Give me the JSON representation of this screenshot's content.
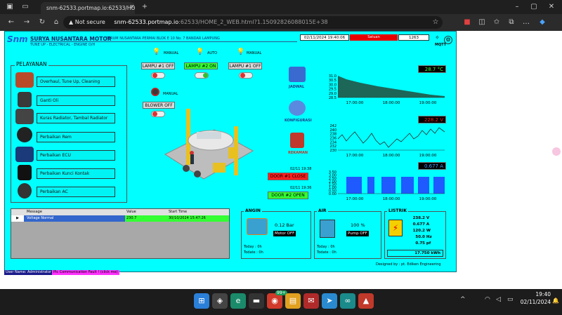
{
  "browser": {
    "tab_title": "snm-62533.portmap.io:62533/HO",
    "not_secure": "Not secure",
    "url_host": "snm-62533.portmap.io",
    "url_path": ":62533/HOME_2_WEB.html?1.15092826088015E+38"
  },
  "app": {
    "company": "SURYA NUSANTARA MOTOR",
    "tagline": "TUNE UP - ELECTRICAL - ENGINE O/H",
    "address": "PERUM NUSANTARA PERMAI BLOK E 10 No. 7    BANDAR LAMPUNG",
    "datetime": "02/11/2024  19:40:06",
    "status_label": "Satuan",
    "status_value": "1263",
    "logo_text": "Snm",
    "right_logo": "MQTT"
  },
  "services": {
    "title": "PELAYANAN",
    "items": [
      {
        "label": "Overhaul, Tune Up, Cleaning"
      },
      {
        "label": "Ganti Oli"
      },
      {
        "label": "Kuras Radiator, Tambal Radiator"
      },
      {
        "label": "Perbaikan Rem"
      },
      {
        "label": "Perbaikan ECU"
      },
      {
        "label": "Perbaikan Kunci Kontak"
      },
      {
        "label": "Perbaikan AC"
      }
    ]
  },
  "lamps": [
    {
      "mode": "MANUAL",
      "button": "LAMPU #1 OFF",
      "state": "OFF",
      "color": "#d9d9d9"
    },
    {
      "mode": "AUTO",
      "button": "LAMPU #2 ON",
      "state": "ON",
      "color": "#33ff33"
    },
    {
      "mode": "MANUAL",
      "button": "LAMPU #1 OFF",
      "state": "OFF",
      "color": "#d9d9d9"
    }
  ],
  "blower": {
    "mode": "MANUAL",
    "button": "BLOWER OFF",
    "state": "OFF"
  },
  "nav": {
    "jadwal": "JADWAL",
    "konfigurasi": "KONFIGURASI",
    "rekaman": "REKAMAN"
  },
  "doors": [
    {
      "time": "02/11  19:38",
      "label": "DOOR #1 CLOSE",
      "color": "#ff2020"
    },
    {
      "time": "02/11  19:36",
      "label": "DOOR #2 OPEN",
      "color": "#33ff33"
    }
  ],
  "trends": [
    {
      "value": "28.7 °C",
      "yticks": [
        "31.0",
        "30.5",
        "30.0",
        "29.5",
        "29.0",
        "28.5"
      ],
      "xticks": [
        "17:00:00",
        "18:00:00",
        "19:00:00"
      ],
      "color": "#1f5f4f",
      "green": true
    },
    {
      "value": "228.2 V",
      "yticks": [
        "242",
        "240",
        "238",
        "236",
        "234",
        "232",
        "230"
      ],
      "xticks": [
        "17:00:00",
        "18:00:00",
        "19:00:00"
      ],
      "color": "#2b2b2b",
      "green": false
    },
    {
      "value": "0.677 A",
      "yticks": [
        "3.50",
        "3.00",
        "2.50",
        "2.00",
        "1.50",
        "1.00",
        "0.50",
        "0.00"
      ],
      "xticks": [
        "17:00:00",
        "18:00:00",
        "19:00:00"
      ],
      "color": "#1e5aff",
      "green": false
    }
  ],
  "alarm_table": {
    "headers": [
      "Message",
      "Value",
      "Start Time"
    ],
    "rows": [
      {
        "message": "Voltage Normal",
        "value": "230.7",
        "start": "30/10/2024 15:47:26"
      }
    ]
  },
  "angin": {
    "title": "ANGIN",
    "pressure": "0.12 Bar",
    "motor": "Motor OFF",
    "today": "Today :  0h",
    "todate": "Todate :  0h"
  },
  "air": {
    "title": "AIR",
    "level": "100 %",
    "pump": "Pump OFF",
    "today": "Today :  0h",
    "todate": "Todate :  0h"
  },
  "listrik": {
    "title": "LISTRIK",
    "rows": [
      {
        "v": "238.2",
        "u": "V"
      },
      {
        "v": "0.677",
        "u": "A"
      },
      {
        "v": "120.2",
        "u": "W"
      },
      {
        "v": "50.0",
        "u": "Hz"
      },
      {
        "v": "0.75",
        "u": "pf"
      }
    ],
    "energy": "17.750 kWh"
  },
  "footer": {
    "designed_by": "Designed by :",
    "company": "pt. Ediken Engineering",
    "user": "User Name: Administrator",
    "comm": "Plc Communication Fault ! (click me)"
  },
  "taskbar": {
    "time": "19:40",
    "date": "02/11/2024",
    "badge": "99+"
  }
}
